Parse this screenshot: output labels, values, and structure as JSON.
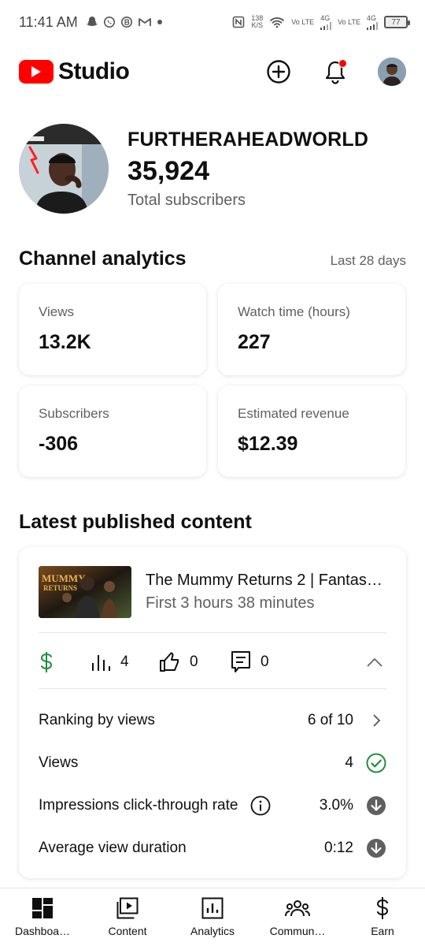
{
  "status_bar": {
    "time": "11:41 AM",
    "net_speed_value": "138",
    "net_speed_unit": "K/S",
    "sim1": "Vo LTE",
    "sim2": "Vo LTE",
    "network1": "4G",
    "network2": "4G",
    "battery": "77"
  },
  "header": {
    "logo_text": "Studio",
    "brand_color": "#ff0000"
  },
  "channel": {
    "name": "FURTHERAHEADWORLD",
    "subscriber_count": "35,924",
    "subscriber_label": "Total subscribers"
  },
  "analytics": {
    "title": "Channel analytics",
    "period": "Last 28 days",
    "cards": [
      {
        "label": "Views",
        "value": "13.2K"
      },
      {
        "label": "Watch time (hours)",
        "value": "227"
      },
      {
        "label": "Subscribers",
        "value": "-306"
      },
      {
        "label": "Estimated revenue",
        "value": "$12.39"
      }
    ]
  },
  "latest": {
    "title": "Latest published content",
    "video": {
      "title": "The Mummy Returns 2 | Fantas…",
      "subtitle": "First 3 hours 38 minutes"
    },
    "stats": {
      "views": "4",
      "likes": "0",
      "comments": "0"
    },
    "metrics": [
      {
        "label": "Ranking by views",
        "value": "6 of 10"
      },
      {
        "label": "Views",
        "value": "4"
      },
      {
        "label": "Impressions click-through rate",
        "value": "3.0%"
      },
      {
        "label": "Average view duration",
        "value": "0:12"
      }
    ],
    "positive_color": "#1e8e3e"
  },
  "bottom_nav": [
    {
      "label": "Dashboa…",
      "icon": "dashboard-icon"
    },
    {
      "label": "Content",
      "icon": "content-icon"
    },
    {
      "label": "Analytics",
      "icon": "analytics-icon"
    },
    {
      "label": "Commun…",
      "icon": "community-icon"
    },
    {
      "label": "Earn",
      "icon": "earn-icon"
    }
  ]
}
